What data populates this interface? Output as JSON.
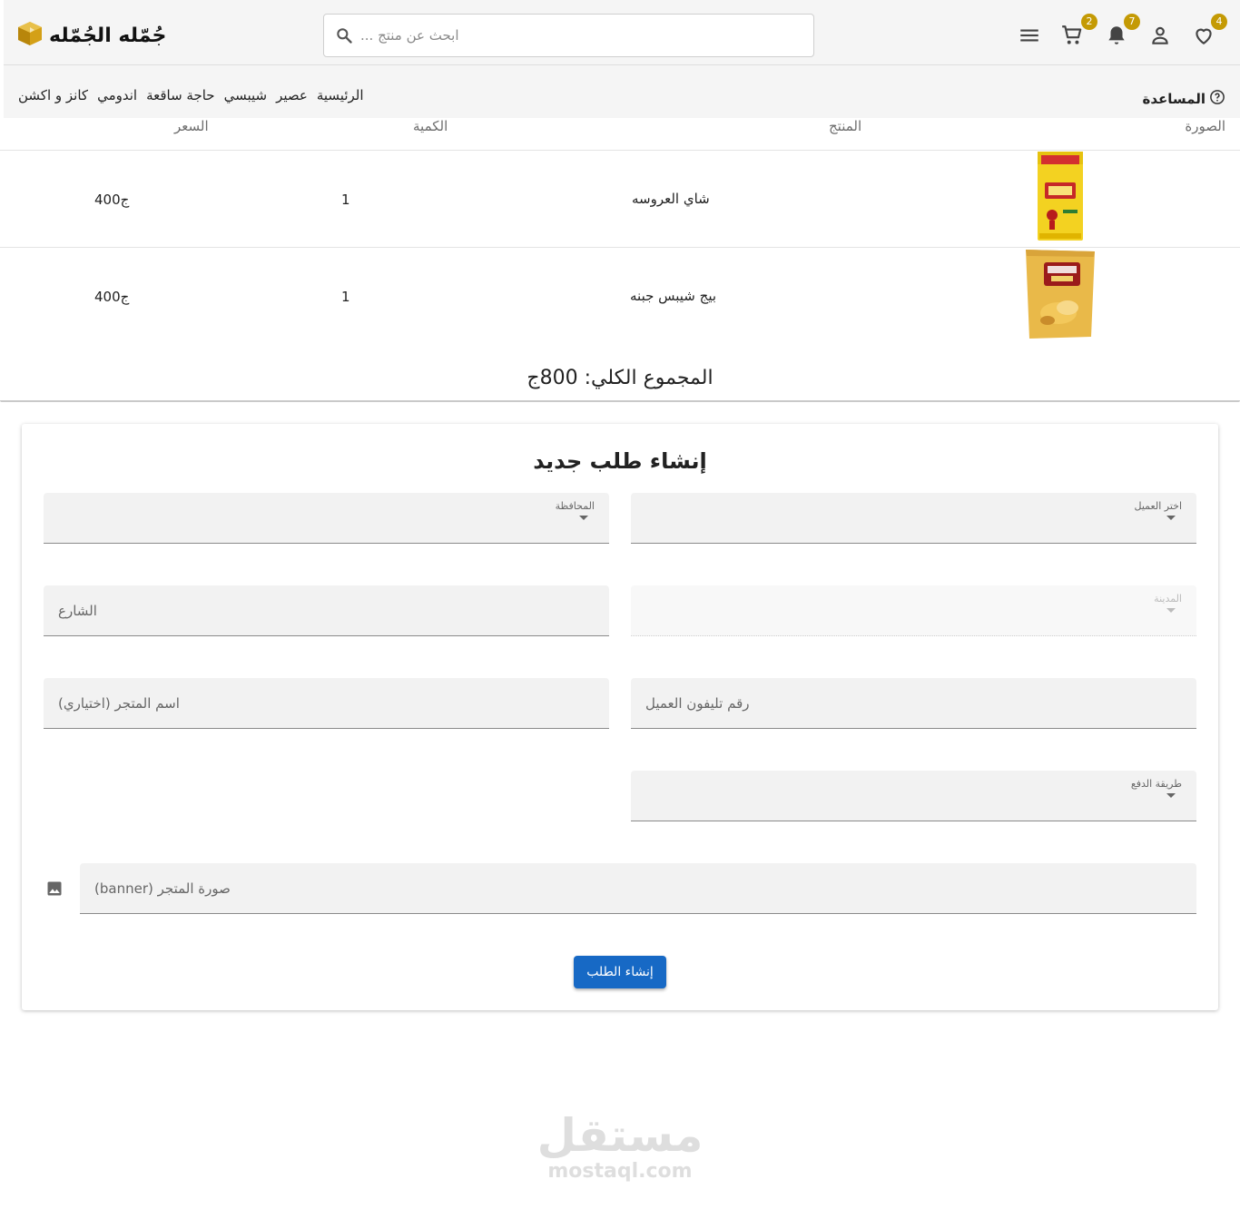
{
  "header": {
    "brand": "جُمّله الجُمّله",
    "search_placeholder": "ابحث عن منتج ...",
    "badges": {
      "favorites": "4",
      "notifications": "7",
      "cart": "2"
    },
    "nav_links": [
      "كانز و اكشن",
      "اندومي",
      "حاجة ساقعة",
      "شيبسي",
      "عصير",
      "الرئيسية"
    ],
    "help_label": "المساعدة"
  },
  "cart_table": {
    "columns": {
      "image": "الصورة",
      "product": "المنتج",
      "quantity": "الكمية",
      "price": "السعر"
    },
    "rows": [
      {
        "product": "شاي العروسه",
        "quantity": "1",
        "price": "400ج"
      },
      {
        "product": "بيج شيبس جبنه",
        "quantity": "1",
        "price": "400ج"
      }
    ],
    "total": "المجموع الكلي: 800ج"
  },
  "form": {
    "title": "إنشاء طلب جديد",
    "client_select_label": "اختر العميل",
    "governorate_label": "المحافظة",
    "city_label": "المدينة",
    "street_placeholder": "الشارع",
    "phone_placeholder": "رقم تليفون العميل",
    "store_name_placeholder": "اسم المتجر (اختياري)",
    "payment_label": "طريقة الدفع",
    "banner_placeholder": "صورة المتجر (banner)",
    "submit_label": "إنشاء الطلب"
  },
  "watermark": {
    "arabic": "مستقل",
    "latin": "mostaql.com"
  },
  "colors": {
    "badge": "#c49a04",
    "primary": "#1769c5",
    "brand_logo": "#d4a017"
  }
}
